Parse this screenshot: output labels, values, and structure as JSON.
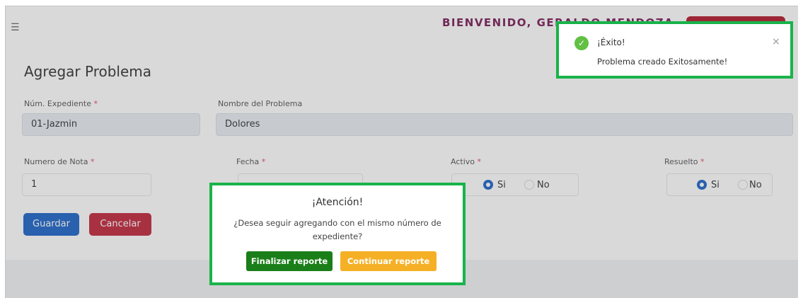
{
  "header": {
    "menu_icon": "menu-indent-icon",
    "welcome": "BIENVENIDO, GERALDO MENDOZA"
  },
  "form": {
    "title": "Agregar Problema",
    "expediente": {
      "label": "Núm. Expediente",
      "required": "*",
      "value": "01-Jazmin"
    },
    "problema": {
      "label": "Nombre del Problema",
      "value": "Dolores"
    },
    "nota": {
      "label": "Numero de Nota",
      "required": "*",
      "value": "1"
    },
    "fecha": {
      "label": "Fecha",
      "required": "*"
    },
    "activo": {
      "label": "Activo",
      "required": "*",
      "options": [
        "Si",
        "No"
      ],
      "selected": "Si"
    },
    "resuelto": {
      "label": "Resuelto",
      "required": "*",
      "options": [
        "Si",
        "No"
      ],
      "selected": "Si"
    },
    "save_label": "Guardar",
    "cancel_label": "Cancelar"
  },
  "dialog": {
    "title": "¡Atención!",
    "message": "¿Desea seguir agregando con el mismo número de expediente?",
    "finish_label": "Finalizar reporte",
    "continue_label": "Continuar reporte"
  },
  "toast": {
    "icon": "check-circle-icon",
    "title": "¡Éxito!",
    "message": "Problema creado Exitosamente!",
    "close": "×"
  },
  "colors": {
    "primary": "#1e66c8",
    "danger": "#c0283d",
    "success": "#1a7f19",
    "warning": "#f5b025",
    "highlight": "#19b34a",
    "welcome": "#7a1d59"
  }
}
